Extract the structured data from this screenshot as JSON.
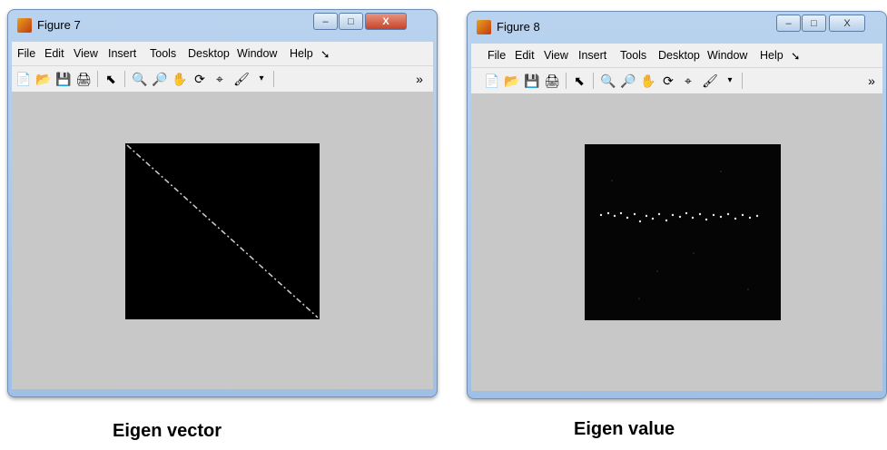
{
  "figure7": {
    "title": "Figure 7",
    "menu": [
      "File",
      "Edit",
      "View",
      "Insert",
      "Tools",
      "Desktop",
      "Window",
      "Help"
    ],
    "overflow_glyph": "»",
    "caption": "Eigen vector"
  },
  "figure8": {
    "title": "Figure 8",
    "menu": [
      "File",
      "Edit",
      "View",
      "Insert",
      "Tools",
      "Desktop",
      "Window",
      "Help"
    ],
    "overflow_glyph": "»",
    "caption": "Eigen value"
  },
  "window_controls": {
    "minimize": "–",
    "maximize": "□",
    "close": "X"
  },
  "toolbar_icons": [
    "new-file-icon",
    "open-folder-icon",
    "save-icon",
    "print-icon",
    "pointer-icon",
    "zoom-in-icon",
    "zoom-out-icon",
    "pan-hand-icon",
    "rotate-3d-icon",
    "data-cursor-icon",
    "brush-icon"
  ],
  "colors": {
    "plot_background": "#000000",
    "figure_background": "#c8c8c8",
    "title_bar": "#b9d3ef"
  }
}
